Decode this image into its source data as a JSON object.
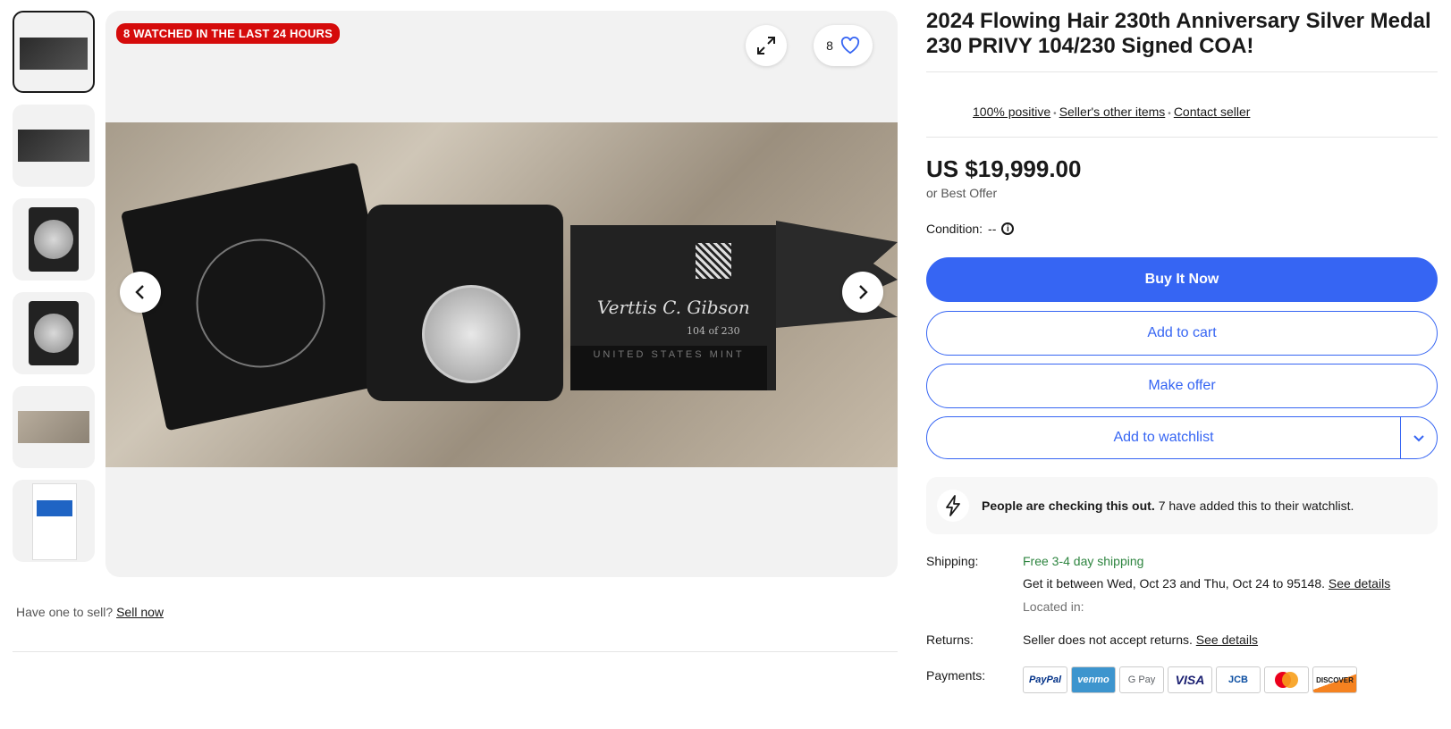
{
  "badge": "8 WATCHED IN THE LAST 24 HOURS",
  "watch_count": "8",
  "image_text": {
    "signature": "Verttis C. Gibson",
    "number": "104 of 230",
    "mint": "UNITED STATES MINT"
  },
  "sell": {
    "prefix": "Have one to sell?",
    "link": "Sell now"
  },
  "title": "2024 Flowing Hair 230th Anniversary Silver Medal 230 PRIVY 104/230 Signed COA!",
  "seller": {
    "positive": "100% positive",
    "other_items": "Seller's other items",
    "contact": "Contact seller"
  },
  "price": "US $19,999.00",
  "best_offer": "or Best Offer",
  "condition": {
    "label": "Condition:",
    "value": "--"
  },
  "buttons": {
    "buy": "Buy It Now",
    "cart": "Add to cart",
    "offer": "Make offer",
    "watchlist": "Add to watchlist"
  },
  "checking": {
    "bold": "People are checking this out.",
    "rest": "7 have added this to their watchlist."
  },
  "shipping": {
    "label": "Shipping:",
    "free": "Free 3-4 day shipping",
    "eta": "Get it between Wed, Oct 23 and Thu, Oct 24 to 95148.",
    "details": "See details",
    "located": "Located in:"
  },
  "returns": {
    "label": "Returns:",
    "text": "Seller does not accept returns.",
    "details": "See details"
  },
  "payments": {
    "label": "Payments:",
    "methods": [
      "PayPal",
      "venmo",
      "G Pay",
      "VISA",
      "JCB",
      "",
      "DISCOVER"
    ]
  },
  "colors": {
    "accent": "#3665f3",
    "badge": "#d50b0b",
    "green": "#2e8540"
  }
}
